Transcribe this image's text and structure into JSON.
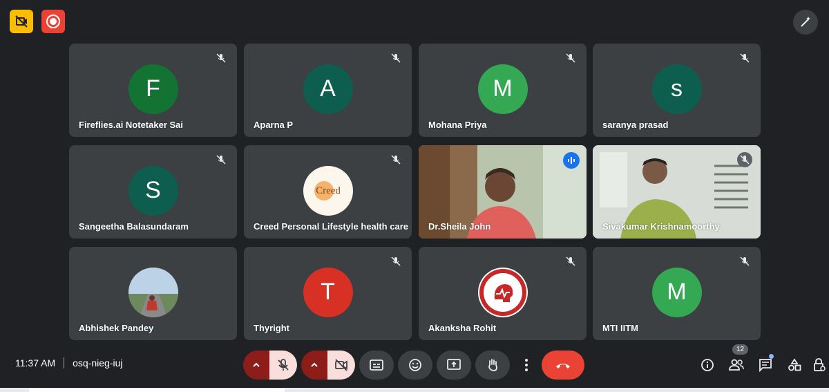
{
  "participants": [
    {
      "name": "Fireflies.ai Notetaker Sai",
      "initial": "F",
      "color": "#137333",
      "muted": true
    },
    {
      "name": "Aparna P",
      "initial": "A",
      "color": "#0d5e4f",
      "muted": true
    },
    {
      "name": "Mohana Priya",
      "initial": "M",
      "color": "#34a853",
      "muted": true
    },
    {
      "name": "saranya prasad",
      "initial": "s",
      "color": "#0d5e4f",
      "muted": true
    },
    {
      "name": "Sangeetha Balasundaram",
      "initial": "S",
      "color": "#0d5e4f",
      "muted": true
    },
    {
      "name": "Creed Personal Lifestyle health care",
      "logo_text": "Creed",
      "muted": true
    },
    {
      "name": "Dr.Sheila John",
      "video": true,
      "speaking": true
    },
    {
      "name": "Sivakumar Krishnamoorthy",
      "video": true,
      "muted": true
    },
    {
      "name": "Abhishek Pandey",
      "photo": true,
      "muted": false
    },
    {
      "name": "Thyright",
      "initial": "T",
      "color": "#d93025",
      "muted": true
    },
    {
      "name": "Akanksha Rohit",
      "logo": true,
      "muted": true
    },
    {
      "name": "MTI IITM",
      "initial": "M",
      "color": "#34a853",
      "muted": true
    }
  ],
  "meeting": {
    "time": "11:37 AM",
    "code": "osq-nieg-iuj"
  },
  "people_count": "12",
  "colors": {
    "background": "#202124",
    "tile": "#3c4043",
    "leave": "#ea4335",
    "accent": "#8ab4f8"
  }
}
